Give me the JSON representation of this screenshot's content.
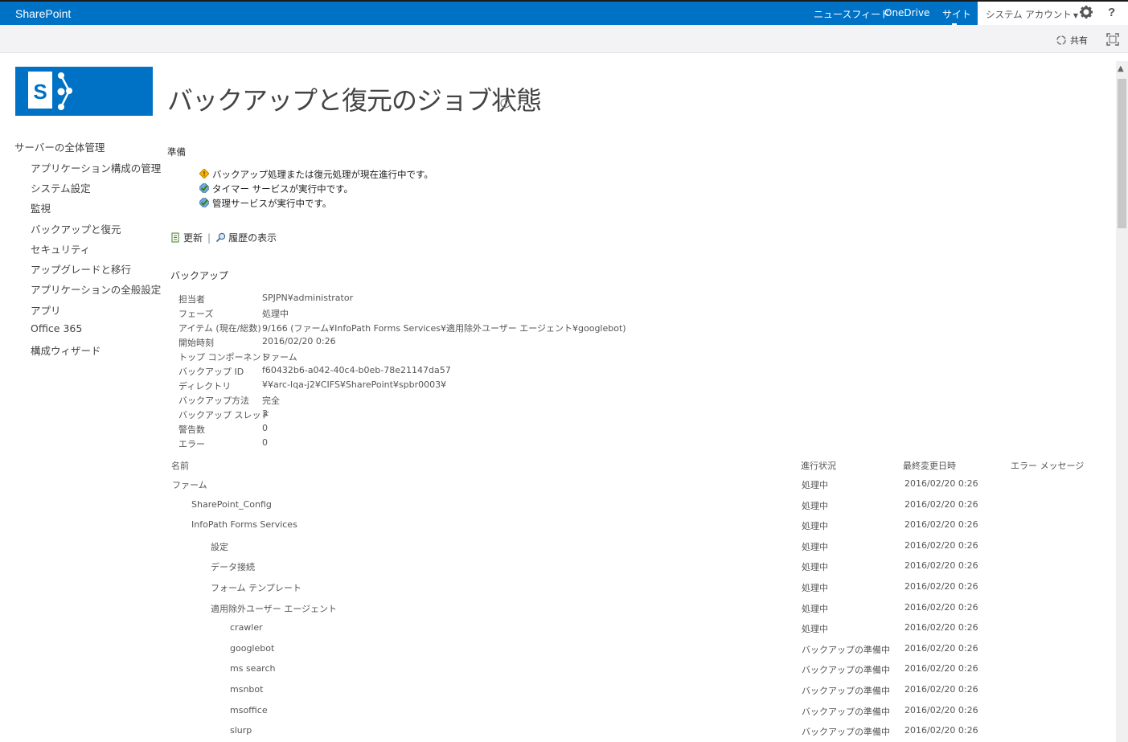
{
  "suite": {
    "brand": "SharePoint",
    "links": [
      "ニュースフィード",
      "OneDrive",
      "サイト"
    ],
    "account": "システム アカウント",
    "help": "?"
  },
  "ribbon": {
    "share": "共有"
  },
  "leftnav": {
    "heading": "サーバーの全体管理",
    "items": [
      "アプリケーション構成の管理",
      "システム設定",
      "監視",
      "バックアップと復元",
      "セキュリティ",
      "アップグレードと移行",
      "アプリケーションの全般設定",
      "アプリ",
      "Office 365",
      "構成ウィザード"
    ]
  },
  "page": {
    "title": "バックアップと復元のジョブ状態"
  },
  "prep": {
    "title": "準備",
    "items": [
      {
        "text": "バックアップ処理または復元処理が現在進行中です。",
        "icon": "warning-icon"
      },
      {
        "text": "タイマー サービスが実行中です。",
        "icon": "check-icon"
      },
      {
        "text": "管理サービスが実行中です。",
        "icon": "check-icon"
      }
    ]
  },
  "actions": {
    "refresh": "更新",
    "sep": "|",
    "history": "履歴の表示"
  },
  "backup": {
    "title": "バックアップ",
    "fields": [
      {
        "label": "担当者",
        "value": "SPJPN¥administrator"
      },
      {
        "label": "フェーズ",
        "value": "処理中"
      },
      {
        "label": "アイテム (現在/総数)",
        "value": "9/166 (ファーム¥InfoPath Forms Services¥適用除外ユーザー エージェント¥googlebot)"
      },
      {
        "label": "開始時刻",
        "value": "2016/02/20 0:26"
      },
      {
        "label": "トップ コンポーネント",
        "value": "ファーム"
      },
      {
        "label": "バックアップ ID",
        "value": "f60432b6-a042-40c4-b0eb-78e21147da57"
      },
      {
        "label": "ディレクトリ",
        "value": "¥¥arc-lqa-j2¥CIFS¥SharePoint¥spbr0003¥"
      },
      {
        "label": "バックアップ方法",
        "value": "完全"
      },
      {
        "label": "バックアップ スレッド",
        "value": "3"
      },
      {
        "label": "警告数",
        "value": "0"
      },
      {
        "label": "エラー",
        "value": "0"
      }
    ]
  },
  "table": {
    "headers": [
      "名前",
      "進行状況",
      "最終変更日時",
      "エラー メッセージ"
    ],
    "rows": [
      {
        "name": "ファーム",
        "level": 0,
        "status": "処理中",
        "modified": "2016/02/20 0:26"
      },
      {
        "name": "SharePoint_Config",
        "level": 1,
        "status": "処理中",
        "modified": "2016/02/20 0:26"
      },
      {
        "name": "InfoPath Forms Services",
        "level": 1,
        "status": "処理中",
        "modified": "2016/02/20 0:26"
      },
      {
        "name": "設定",
        "level": 2,
        "status": "処理中",
        "modified": "2016/02/20 0:26"
      },
      {
        "name": "データ接続",
        "level": 2,
        "status": "処理中",
        "modified": "2016/02/20 0:26"
      },
      {
        "name": "フォーム テンプレート",
        "level": 2,
        "status": "処理中",
        "modified": "2016/02/20 0:26"
      },
      {
        "name": "適用除外ユーザー エージェント",
        "level": 2,
        "status": "処理中",
        "modified": "2016/02/20 0:26"
      },
      {
        "name": "crawler",
        "level": 3,
        "status": "処理中",
        "modified": "2016/02/20 0:26"
      },
      {
        "name": "googlebot",
        "level": 3,
        "status": "バックアップの準備中",
        "modified": "2016/02/20 0:26"
      },
      {
        "name": "ms search",
        "level": 3,
        "status": "バックアップの準備中",
        "modified": "2016/02/20 0:26"
      },
      {
        "name": "msnbot",
        "level": 3,
        "status": "バックアップの準備中",
        "modified": "2016/02/20 0:26"
      },
      {
        "name": "msoffice",
        "level": 3,
        "status": "バックアップの準備中",
        "modified": "2016/02/20 0:26"
      },
      {
        "name": "slurp",
        "level": 3,
        "status": "バックアップの準備中",
        "modified": "2016/02/20 0:26"
      }
    ]
  },
  "colors": {
    "suite": "#0072c6",
    "text": "#444444"
  }
}
